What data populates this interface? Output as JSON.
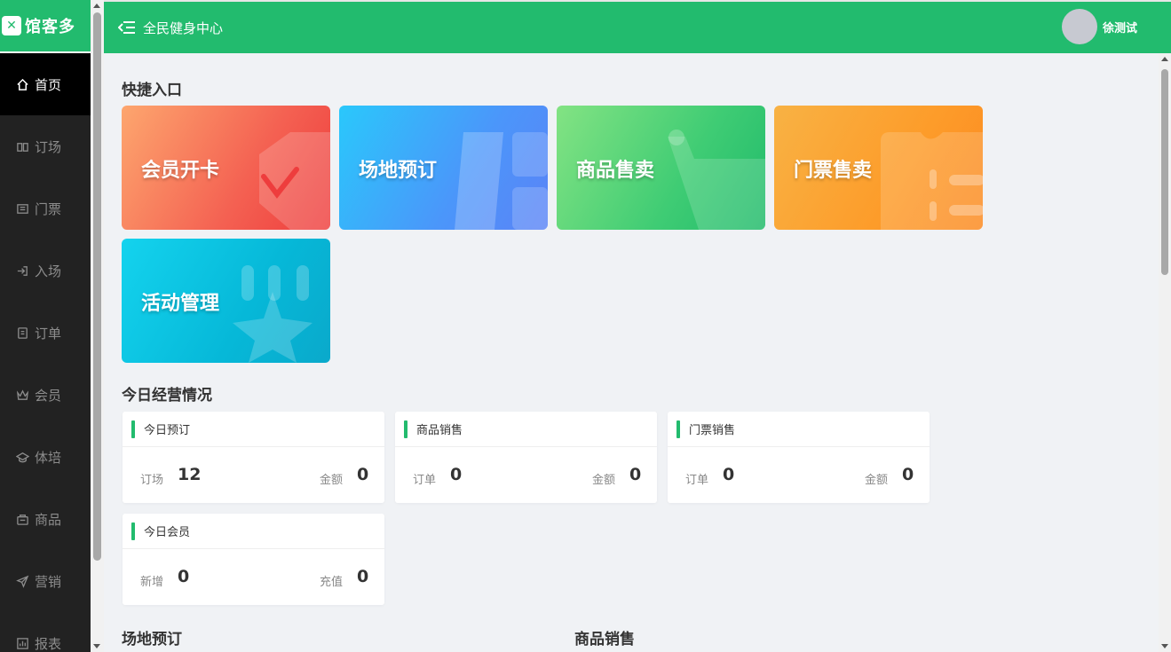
{
  "logo": {
    "mark": "✕",
    "text": "馆客多"
  },
  "sidebar": {
    "items": [
      {
        "label": "首页",
        "icon": "home-icon"
      },
      {
        "label": "订场",
        "icon": "venue-icon"
      },
      {
        "label": "门票",
        "icon": "ticket-icon"
      },
      {
        "label": "入场",
        "icon": "entry-icon"
      },
      {
        "label": "订单",
        "icon": "order-icon"
      },
      {
        "label": "会员",
        "icon": "crown-icon"
      },
      {
        "label": "体培",
        "icon": "training-icon"
      },
      {
        "label": "商品",
        "icon": "bag-icon"
      },
      {
        "label": "营销",
        "icon": "send-icon"
      },
      {
        "label": "报表",
        "icon": "chart-icon"
      }
    ]
  },
  "header": {
    "center_name": "全民健身中心",
    "username": "徐测试"
  },
  "quick_entry": {
    "title": "快捷入口",
    "items": [
      "会员开卡",
      "场地预订",
      "商品售卖",
      "门票售卖",
      "活动管理"
    ]
  },
  "today": {
    "title": "今日经营情况",
    "cards": [
      {
        "title": "今日预订",
        "left_label": "订场",
        "left_value": "12",
        "right_label": "金额",
        "right_value": "0"
      },
      {
        "title": "商品销售",
        "left_label": "订单",
        "left_value": "0",
        "right_label": "金额",
        "right_value": "0"
      },
      {
        "title": "门票销售",
        "left_label": "订单",
        "left_value": "0",
        "right_label": "金额",
        "right_value": "0"
      },
      {
        "title": "今日会员",
        "left_label": "新增",
        "left_value": "0",
        "right_label": "充值",
        "right_value": "0"
      }
    ]
  },
  "bottom_sections": {
    "venue": "场地预订",
    "goods": "商品销售"
  },
  "colors": {
    "brand": "#22bb6e",
    "sidebar": "#222222",
    "active": "#000000"
  }
}
